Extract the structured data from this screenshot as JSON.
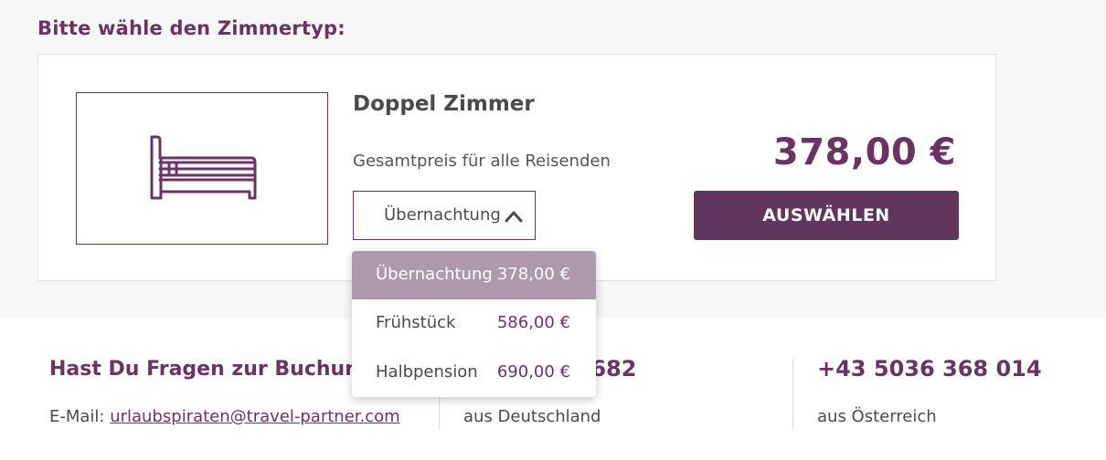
{
  "heading": "Bitte wähle den Zimmertyp:",
  "room": {
    "title": "Doppel Zimmer",
    "price_label": "Gesamtpreis für alle Reisenden",
    "selected_board": "Übernachtung",
    "total_price": "378,00 €",
    "select_button": "AUSWÄHLEN",
    "image_icon": "bed-icon"
  },
  "dropdown": {
    "options": [
      {
        "label": "Übernachtung",
        "price": "378,00 €",
        "selected": true
      },
      {
        "label": "Frühstück",
        "price": "586,00 €",
        "selected": false
      },
      {
        "label": "Halbpension",
        "price": "690,00 €",
        "selected": false
      }
    ]
  },
  "footer": {
    "question": "Hast Du Fragen zur Buchung?",
    "email_prefix": "E-Mail: ",
    "email": "urlaubspiraten@travel-partner.com",
    "phone_de": "+49 ... 74 682",
    "phone_de_visible": "74 682",
    "phone_de_note": "aus Deutschland",
    "phone_at": "+43 5036 368 014",
    "phone_at_note": "aus Österreich"
  },
  "colors": {
    "accent": "#6b3363",
    "button": "#62355c",
    "dropdown_active": "#ad98ac",
    "page_bg": "#f7f7f7"
  }
}
